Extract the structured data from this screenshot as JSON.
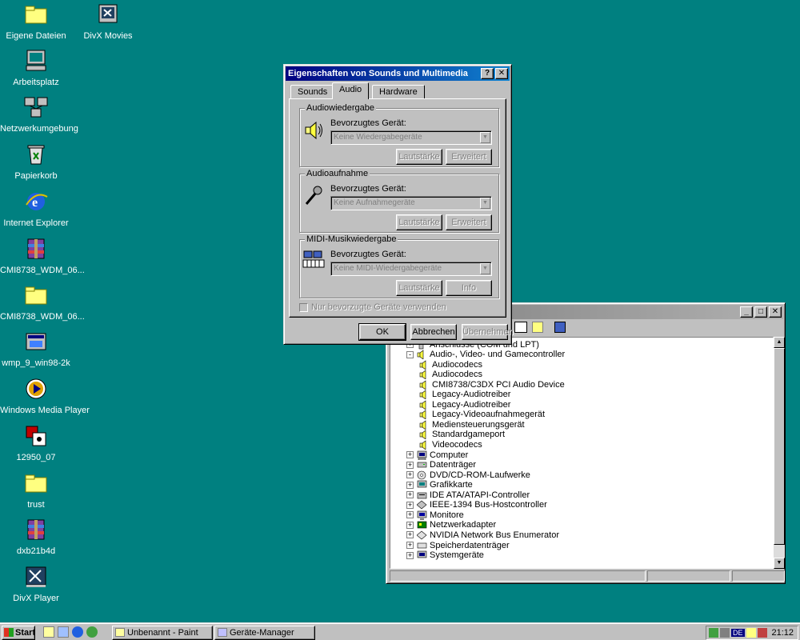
{
  "desktop": {
    "icons": [
      {
        "label": "Eigene Dateien",
        "icon": "folder-icon"
      },
      {
        "label": "DivX Movies",
        "icon": "divx-shortcut-icon"
      },
      {
        "label": "Arbeitsplatz",
        "icon": "computer-icon"
      },
      {
        "label": "Netzwerkumgebung",
        "icon": "network-icon"
      },
      {
        "label": "Papierkorb",
        "icon": "recycle-bin-icon"
      },
      {
        "label": "Internet Explorer",
        "icon": "ie-icon"
      },
      {
        "label": "CMI8738_WDM_06...",
        "icon": "winrar-icon"
      },
      {
        "label": "CMI8738_WDM_06...",
        "icon": "folder-icon"
      },
      {
        "label": "wmp_9_win98-2k",
        "icon": "installer-icon"
      },
      {
        "label": "Windows Media Player",
        "icon": "media-player-icon"
      },
      {
        "label": "12950_07",
        "icon": "exe-icon"
      },
      {
        "label": "trust",
        "icon": "folder-icon"
      },
      {
        "label": "dxb21b4d",
        "icon": "winrar-icon"
      },
      {
        "label": "DivX Player",
        "icon": "divx-icon"
      }
    ]
  },
  "dialog": {
    "title": "Eigenschaften von Sounds und Multimedia",
    "tabs": [
      "Sounds",
      "Audio",
      "Hardware"
    ],
    "selected_tab": "Audio",
    "playback": {
      "group": "Audiowiedergabe",
      "device_label": "Bevorzugtes Gerät:",
      "device_value": "Keine Wiedergabegeräte",
      "buttons": [
        "Lautstärke",
        "Erweitert"
      ]
    },
    "recording": {
      "group": "Audioaufnahme",
      "device_label": "Bevorzugtes Gerät:",
      "device_value": "Keine Aufnahmegeräte",
      "buttons": [
        "Lautstärke",
        "Erweitert"
      ]
    },
    "midi": {
      "group": "MIDI-Musikwiedergabe",
      "device_label": "Bevorzugtes Gerät:",
      "device_value": "Keine MIDI-Wiedergabegeräte",
      "buttons": [
        "Lautstärke",
        "Info"
      ]
    },
    "checkbox_label": "Nur bevorzugte Geräte verwenden",
    "ok": "OK",
    "cancel": "Abbrechen",
    "apply": "Übernehmen"
  },
  "device_manager": {
    "tree": [
      {
        "label": "Anschlüsse (COM und LPT)",
        "level": 0,
        "expander": "+",
        "icon": "port-icon"
      },
      {
        "label": "Audio-, Video- und Gamecontroller",
        "level": 0,
        "expander": "-",
        "icon": "speaker-icon"
      },
      {
        "label": "Audiocodecs",
        "level": 1,
        "icon": "speaker-icon"
      },
      {
        "label": "Audiocodecs",
        "level": 1,
        "icon": "speaker-icon"
      },
      {
        "label": "CMI8738/C3DX PCI Audio Device",
        "level": 1,
        "icon": "speaker-icon"
      },
      {
        "label": "Legacy-Audiotreiber",
        "level": 1,
        "icon": "speaker-icon"
      },
      {
        "label": "Legacy-Audiotreiber",
        "level": 1,
        "icon": "speaker-icon"
      },
      {
        "label": "Legacy-Videoaufnahmegerät",
        "level": 1,
        "icon": "speaker-icon"
      },
      {
        "label": "Mediensteuerungsgerät",
        "level": 1,
        "icon": "speaker-icon"
      },
      {
        "label": "Standardgameport",
        "level": 1,
        "icon": "speaker-icon"
      },
      {
        "label": "Videocodecs",
        "level": 1,
        "icon": "speaker-icon"
      },
      {
        "label": "Computer",
        "level": 0,
        "expander": "+",
        "icon": "computer-icon"
      },
      {
        "label": "Datenträger",
        "level": 0,
        "expander": "+",
        "icon": "disk-icon"
      },
      {
        "label": "DVD/CD-ROM-Laufwerke",
        "level": 0,
        "expander": "+",
        "icon": "cdrom-icon"
      },
      {
        "label": "Grafikkarte",
        "level": 0,
        "expander": "+",
        "icon": "display-adapter-icon"
      },
      {
        "label": "IDE ATA/ATAPI-Controller",
        "level": 0,
        "expander": "+",
        "icon": "ide-icon"
      },
      {
        "label": "IEEE-1394 Bus-Hostcontroller",
        "level": 0,
        "expander": "+",
        "icon": "firewire-icon"
      },
      {
        "label": "Monitore",
        "level": 0,
        "expander": "+",
        "icon": "monitor-icon"
      },
      {
        "label": "Netzwerkadapter",
        "level": 0,
        "expander": "+",
        "icon": "network-adapter-icon"
      },
      {
        "label": "NVIDIA Network Bus Enumerator",
        "level": 0,
        "expander": "+",
        "icon": "bus-icon"
      },
      {
        "label": "Speicherdatenträger",
        "level": 0,
        "expander": "+",
        "icon": "storage-icon"
      },
      {
        "label": "Systemgeräte",
        "level": 0,
        "expander": "+",
        "icon": "system-icon"
      }
    ]
  },
  "taskbar": {
    "start": "Start",
    "tasks": [
      "Unbenannt - Paint",
      "Geräte-Manager"
    ],
    "language": "DE",
    "clock": "21:12"
  }
}
